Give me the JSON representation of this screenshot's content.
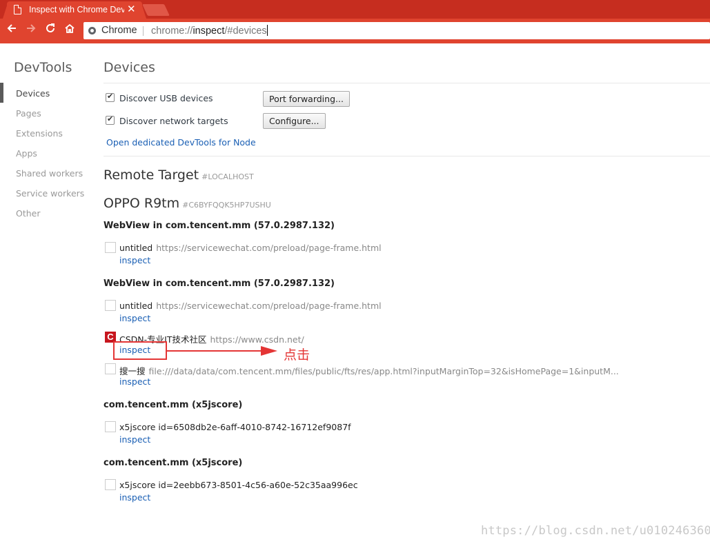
{
  "browser": {
    "tab_title": "Inspect with Chrome Developer Tools",
    "tab_close": "✕",
    "omnibox_scheme_label": "Chrome",
    "url_prefix": "chrome://",
    "url_host": "inspect",
    "url_rest": "/#devices",
    "nav_icons": [
      "back-arrow-icon",
      "forward-arrow-icon",
      "reload-icon",
      "home-icon"
    ]
  },
  "sidebar": {
    "title": "DevTools",
    "items": [
      {
        "label": "Devices",
        "selected": true
      },
      {
        "label": "Pages",
        "selected": false
      },
      {
        "label": "Extensions",
        "selected": false
      },
      {
        "label": "Apps",
        "selected": false
      },
      {
        "label": "Shared workers",
        "selected": false
      },
      {
        "label": "Service workers",
        "selected": false
      },
      {
        "label": "Other",
        "selected": false
      }
    ]
  },
  "devices": {
    "heading": "Devices",
    "discover_usb": {
      "label": "Discover USB devices",
      "checked": true
    },
    "discover_network": {
      "label": "Discover network targets",
      "checked": true
    },
    "port_forwarding_button": "Port forwarding...",
    "configure_button": "Configure...",
    "open_node_link": "Open dedicated DevTools for Node"
  },
  "remote": {
    "heading": "Remote Target",
    "hash": "#LOCALHOST",
    "device_name": "OPPO R9tm",
    "device_serial": "#C6BYFQQK5HP7USHU",
    "browsers": [
      {
        "name": "WebView in com.tencent.mm (57.0.2987.132)",
        "targets": [
          {
            "title": "untitled",
            "url": "https://servicewechat.com/preload/page-frame.html",
            "action": "inspect"
          }
        ]
      },
      {
        "name": "WebView in com.tencent.mm (57.0.2987.132)",
        "targets": [
          {
            "title": "untitled",
            "url": "https://servicewechat.com/preload/page-frame.html",
            "action": "inspect"
          },
          {
            "title": "CSDN-专业IT技术社区",
            "url": "https://www.csdn.net/",
            "action": "inspect",
            "favicon": "C"
          },
          {
            "title": "搜一搜",
            "url": "file:///data/data/com.tencent.mm/files/public/fts/res/app.html?inputMarginTop=32&isHomePage=1&inputM...",
            "action": "inspect"
          }
        ]
      },
      {
        "name": "com.tencent.mm (x5jscore)",
        "targets": [
          {
            "title": "x5jscore id=6508db2e-6aff-4010-8742-16712ef9087f",
            "url": "",
            "action": "inspect"
          }
        ]
      },
      {
        "name": "com.tencent.mm (x5jscore)",
        "targets": [
          {
            "title": "x5jscore id=2eebb673-8501-4c56-a60e-52c35aa996ec",
            "url": "",
            "action": "inspect"
          }
        ]
      }
    ]
  },
  "annotation": {
    "label": "点击",
    "color": "#e43535"
  },
  "watermark": "https://blog.csdn.net/u010246360"
}
